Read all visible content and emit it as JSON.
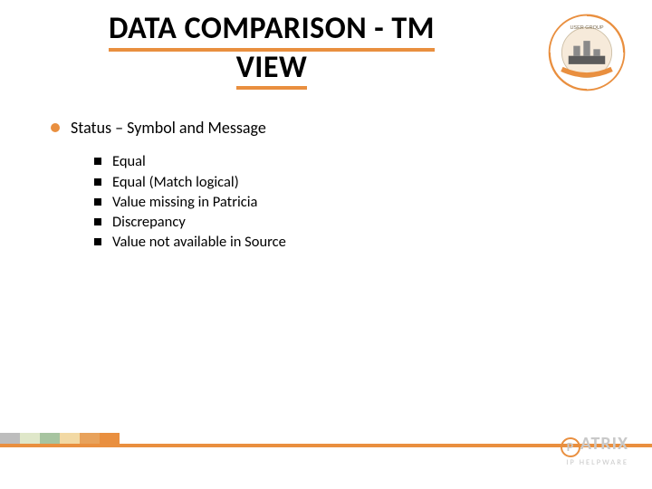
{
  "title_line1": "DATA COMPARISON - TM",
  "title_line2": "VIEW",
  "lvl1_text": "Status – Symbol and Message",
  "sub_items": [
    "Equal",
    "Equal (Match logical)",
    "Value missing in Patricia",
    "Discrepancy",
    "Value not available in Source"
  ],
  "brand_name": "ATRIX",
  "brand_tag": "IP HELPWARE",
  "stripe_colors": [
    "#bdbdbd",
    "#dfe7c9",
    "#a7c4a0",
    "#f2d9a4",
    "#e8a25b",
    "#e98f3f"
  ],
  "accent": "#e98f3f"
}
